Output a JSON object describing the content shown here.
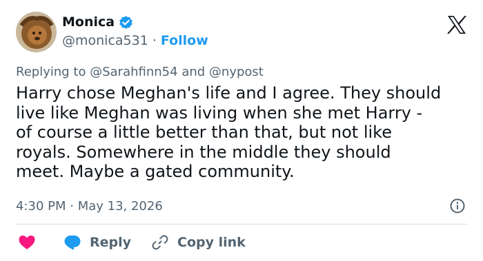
{
  "author": {
    "name": "Monica",
    "handle": "@monica531",
    "separator": "·",
    "follow_label": "Follow"
  },
  "reply_context": {
    "prefix": "Replying to",
    "mention_1": "@Sarahfinn54",
    "conjunction": "and",
    "mention_2": "@nypost"
  },
  "tweet": {
    "lines": [
      "Harry chose Meghan's life and I agree. They should",
      "live like Meghan was living when she met Harry -",
      "of course a little better than that, but not like",
      "royals. Somewhere in the middle they should",
      "meet. Maybe a gated community."
    ],
    "timestamp": "4:30 PM · May 13, 2026"
  },
  "actions": {
    "reply_label": "Reply",
    "copy_link_label": "Copy link"
  },
  "icons": {
    "verified": "verified-badge-icon",
    "platform": "x-logo-icon",
    "info": "info-icon",
    "like": "heart-icon",
    "reply": "speech-bubble-icon",
    "copy": "link-icon"
  },
  "colors": {
    "accent": "#1d9bf0",
    "text": "#0f1419",
    "muted": "#536471",
    "like": "#f91880",
    "divider": "#cfd9de"
  }
}
